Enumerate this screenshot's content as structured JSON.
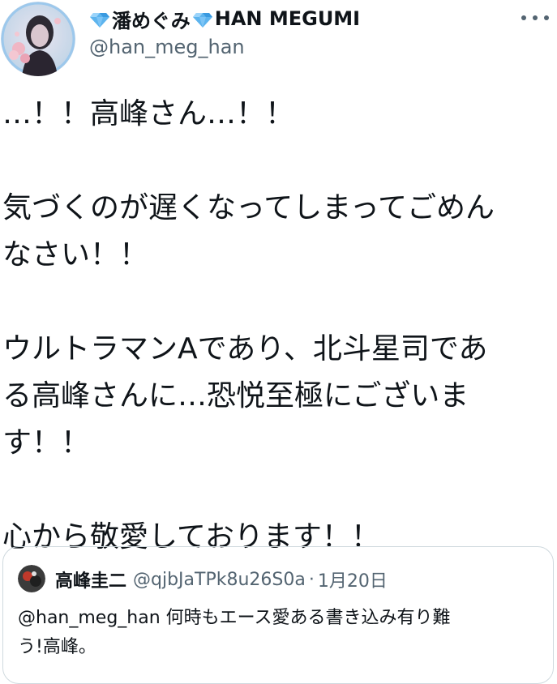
{
  "author": {
    "display_name_prefix_emoji": "💎",
    "display_name_part1": "潘めぐみ",
    "display_name_mid_emoji": "💎",
    "display_name_part2": "HAN MEGUMI",
    "handle": "@han_meg_han",
    "avatar_icon": "user-avatar-photo"
  },
  "more_menu_icon": "more-horizontal-icon",
  "tweet": {
    "lines": [
      "…！！高峰さん…！！",
      "",
      "気づくのが遅くなってしまってごめん",
      "なさい！！",
      "",
      "ウルトラマンAであり、北斗星司であ",
      "る高峰さんに…恐悦至極にございま",
      "す！！",
      "",
      "心から敬愛しております！！"
    ]
  },
  "quoted_tweet": {
    "name": "高峰圭二",
    "handle": "@qjbJaTPk8u26S0a",
    "separator": "·",
    "date": "1月20日",
    "text_line1": "@han_meg_han 何時もエース愛ある書き込み有り難",
    "text_line2": "う!高峰。",
    "avatar_icon": "user-avatar-photo"
  },
  "colors": {
    "text_primary": "#0f1419",
    "text_secondary": "#536471",
    "border": "#cfd9de",
    "diamond": "#5db4ee"
  }
}
